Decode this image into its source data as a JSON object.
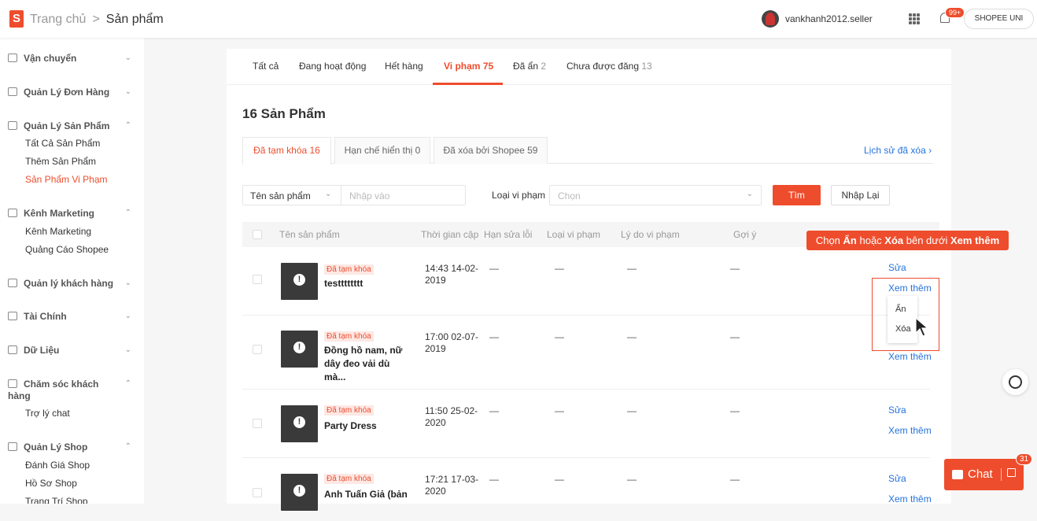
{
  "header": {
    "logo": "S",
    "crumb_home": "Trang chủ",
    "crumb_sep": ">",
    "crumb_current": "Sản phẩm",
    "username": "vankhanh2012.seller",
    "notif_count": "99+",
    "shop_button": "SHOPEE UNI"
  },
  "sidebar": {
    "sections": [
      {
        "label": "Vận chuyển",
        "icon": "truck-icon"
      },
      {
        "label": "Quản Lý Đơn Hàng",
        "icon": "clipboard-icon"
      },
      {
        "label": "Quản Lý Sản Phẩm",
        "icon": "box-icon"
      },
      {
        "label": "Kênh Marketing",
        "icon": "tag-icon"
      },
      {
        "label": "Quản lý khách hàng",
        "icon": "users-icon"
      },
      {
        "label": "Tài Chính",
        "icon": "wallet-icon"
      },
      {
        "label": "Dữ Liệu",
        "icon": "chart-icon"
      },
      {
        "label": "Chăm sóc khách hàng",
        "icon": "support-icon"
      },
      {
        "label": "Quản Lý Shop",
        "icon": "shop-icon"
      }
    ],
    "sub_products": [
      "Tất Cả Sản Phẩm",
      "Thêm Sản Phẩm",
      "Sản Phẩm Vi Phạm"
    ],
    "sub_marketing": [
      "Kênh Marketing",
      "Quảng Cáo Shopee"
    ],
    "sub_care": [
      "Trợ lý chat"
    ],
    "sub_shop": [
      "Đánh Giá Shop",
      "Hồ Sơ Shop",
      "Trang Trí Shop"
    ]
  },
  "tabs": [
    {
      "label": "Tất cả",
      "count": ""
    },
    {
      "label": "Đang hoạt động",
      "count": ""
    },
    {
      "label": "Hết hàng",
      "count": ""
    },
    {
      "label": "Vi phạm",
      "count": "75"
    },
    {
      "label": "Đã ẩn",
      "count": "2"
    },
    {
      "label": "Chưa được đăng",
      "count": "13"
    }
  ],
  "title": "16 Sản Phẩm",
  "subtabs": [
    "Đã tạm khóa 16",
    "Hạn chế hiển thị 0",
    "Đã xóa bởi Shopee 59"
  ],
  "history_link": "Lịch sử đã xóa",
  "filter": {
    "field": "Tên sản phẩm",
    "input_placeholder": "Nhập vào",
    "violation_label": "Loại vi phạm",
    "violation_placeholder": "Chọn",
    "search": "Tìm",
    "reset": "Nhập Lại"
  },
  "columns": [
    "Tên sản phẩm",
    "Thời gian cập",
    "Hạn sửa lỗi",
    "Loại vi phạm",
    "Lý do vi phạm",
    "Gợi ý"
  ],
  "rows": [
    {
      "tag": "Đã tạm khóa",
      "name": "testttttttt",
      "time": "14:43 14-02-2019",
      "deadline": "—",
      "type": "—",
      "reason": "—",
      "hint": "—",
      "edit": "Sửa",
      "more": "Xem thêm"
    },
    {
      "tag": "Đã tạm khóa",
      "name": "Đồng hồ nam, nữ dây đeo vải dù mà...",
      "time": "17:00 02-07-2019",
      "deadline": "—",
      "type": "—",
      "reason": "—",
      "hint": "—",
      "edit": "",
      "more": "Xem thêm"
    },
    {
      "tag": "Đã tạm khóa",
      "name": "Party Dress",
      "time": "11:50 25-02-2020",
      "deadline": "—",
      "type": "—",
      "reason": "—",
      "hint": "—",
      "edit": "Sửa",
      "more": "Xem thêm"
    },
    {
      "tag": "Đã tạm khóa",
      "name": "Anh Tuấn Giả (bản",
      "time": "17:21 17-03-2020",
      "deadline": "—",
      "type": "—",
      "reason": "—",
      "hint": "—",
      "edit": "Sửa",
      "more": "Xem thêm"
    }
  ],
  "dropdown": {
    "hide": "Ẩn",
    "delete": "Xóa"
  },
  "annotation": {
    "pre": "Chọn ",
    "hide": "Ẩn",
    "mid1": " hoặc ",
    "delete": "Xóa",
    "mid2": " bên dưới ",
    "more": "Xem thêm"
  },
  "chat": {
    "label": "Chat",
    "badge": "31"
  },
  "colors": {
    "accent": "#ee4d2d",
    "link": "#2673dd"
  }
}
